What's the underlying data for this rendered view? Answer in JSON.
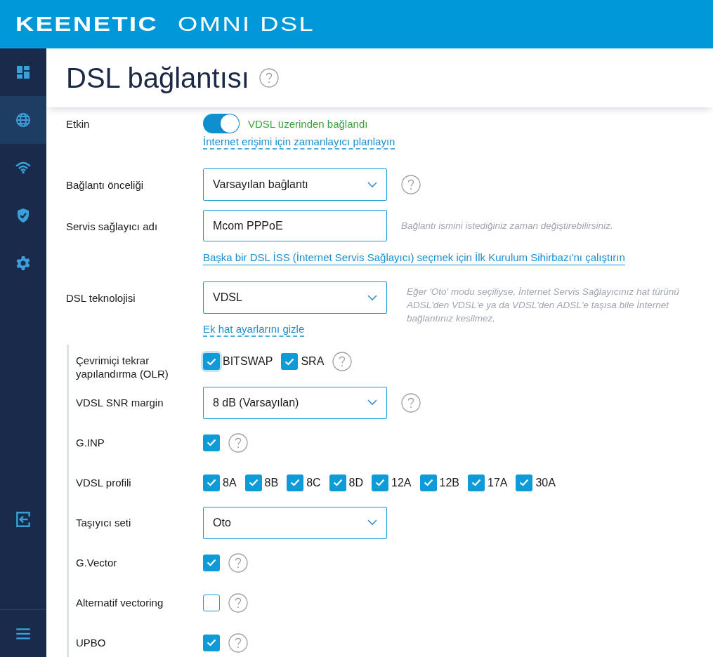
{
  "header": {
    "brand": "KEENETIC",
    "model": "OMNI DSL"
  },
  "sidebar": {
    "items": [
      {
        "kind": "dashboard",
        "selected": false
      },
      {
        "kind": "globe",
        "selected": true
      },
      {
        "kind": "wifi",
        "selected": false
      },
      {
        "kind": "shield",
        "selected": false
      },
      {
        "kind": "gear",
        "selected": false
      }
    ],
    "bottom": [
      {
        "kind": "exit"
      },
      {
        "kind": "menu"
      }
    ]
  },
  "page": {
    "title": "DSL bağlantısı",
    "help": true
  },
  "rows": [
    {
      "kind": "toggle",
      "label": "Etkin",
      "on": true,
      "status": "VDSL üzerinden bağlandı",
      "link": {
        "kind": "dashed",
        "text": "İnternet erişimi için zamanlayıcı planlayın"
      }
    },
    {
      "kind": "select",
      "label": "Bağlantı önceliği",
      "value": "Varsayılan bağlantı",
      "help": true
    },
    {
      "kind": "input",
      "label": "Servis sağlayıcı adı",
      "value": "Mcom PPPoE",
      "hint": "Bağlantı ismini istediğiniz zaman değiştirebilirsiniz.",
      "link": {
        "kind": "solid",
        "text": "Başka bir DSL İSS (İnternet Servis Sağlayıcı) seçmek için İlk Kurulum Sihirbazı'nı çalıştırın"
      }
    },
    {
      "kind": "select",
      "label": "DSL teknolojisi",
      "value": "VDSL",
      "help": false,
      "hint": "Eğer 'Oto' modu seçiliyse, İnternet Servis Sağlayıcınız hat türünü ADSL'den VDSL'e ya da VDSL'den ADSL'e taşısa bile İnternet bağlantınız kesilmez.",
      "link": {
        "kind": "dashed",
        "text": "Ek hat ayarlarını gizle"
      }
    }
  ],
  "advanced": [
    {
      "kind": "checks",
      "label": "Çevrimiçi tekrar yapılandırma (OLR)",
      "help": true,
      "options": [
        {
          "label": "BITSWAP",
          "checked": true,
          "focused": true
        },
        {
          "label": "SRA",
          "checked": true,
          "focused": false
        }
      ]
    },
    {
      "kind": "select",
      "label": "VDSL SNR margin",
      "value": "8 dB (Varsayılan)",
      "help": true
    },
    {
      "kind": "checks",
      "label": "G.INP",
      "help": true,
      "options": [
        {
          "checked": true,
          "focused": false
        }
      ]
    },
    {
      "kind": "checks",
      "label": "VDSL profili",
      "help": false,
      "options": [
        {
          "label": "8A",
          "checked": true,
          "focused": false
        },
        {
          "label": "8B",
          "checked": true,
          "focused": false
        },
        {
          "label": "8C",
          "checked": true,
          "focused": false
        },
        {
          "label": "8D",
          "checked": true,
          "focused": false
        },
        {
          "label": "12A",
          "checked": true,
          "focused": false
        },
        {
          "label": "12B",
          "checked": true,
          "focused": false
        },
        {
          "label": "17A",
          "checked": true,
          "focused": false
        },
        {
          "label": "30A",
          "checked": true,
          "focused": false
        }
      ]
    },
    {
      "kind": "select",
      "label": "Taşıyıcı seti",
      "value": "Oto",
      "help": false
    },
    {
      "kind": "checks",
      "label": "G.Vector",
      "help": true,
      "options": [
        {
          "checked": true,
          "focused": false
        }
      ]
    },
    {
      "kind": "checks",
      "label": "Alternatif vectoring",
      "help": true,
      "options": [
        {
          "checked": false,
          "focused": false
        }
      ]
    },
    {
      "kind": "checks",
      "label": "UPBO",
      "help": true,
      "options": [
        {
          "checked": true,
          "focused": false
        }
      ]
    }
  ]
}
